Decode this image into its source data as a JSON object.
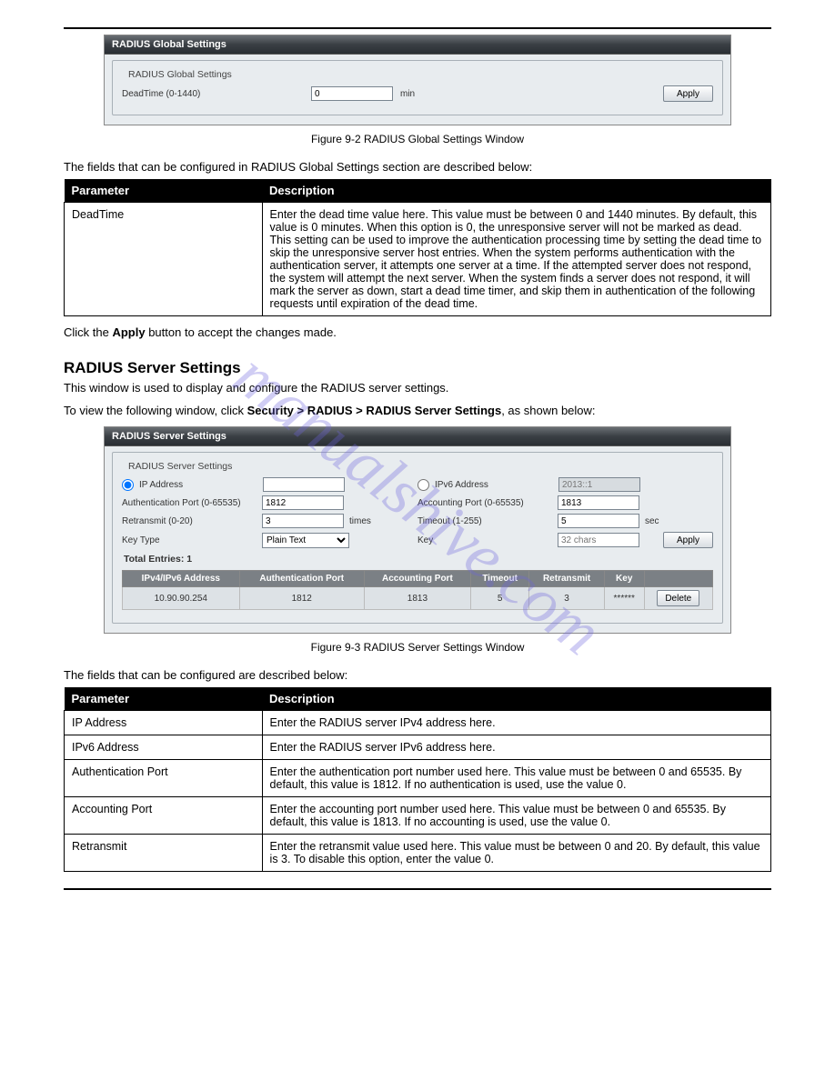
{
  "watermark": "manualshive.com",
  "screenshot1": {
    "title": "RADIUS Global Settings",
    "legend": "RADIUS Global Settings",
    "deadtime_label": "DeadTime (0-1440)",
    "deadtime_value": "0",
    "deadtime_unit": "min",
    "apply": "Apply",
    "caption": "Figure 9-2 RADIUS Global Settings Window"
  },
  "body1": {
    "intro": "The fields that can be configured in RADIUS Global Settings section are described below:"
  },
  "table1": {
    "hParam": "Parameter",
    "hDesc": "Description",
    "rows": [
      {
        "param": "DeadTime",
        "desc": "Enter the dead time value here. This value must be between 0 and 1440 minutes. By default, this value is 0 minutes. When this option is 0, the unresponsive server will not be marked as dead. This setting can be used to improve the authentication processing time by setting the dead time to skip the unresponsive server host entries. When the system performs authentication with the authentication server, it attempts one server at a time. If the attempted server does not respond, the system will attempt the next server. When the system finds a server does not respond, it will mark the server as down, start a dead time timer, and skip them in authentication of the following requests until expiration of the dead time."
      }
    ]
  },
  "apply_note": "Click the Apply button to accept the changes made.",
  "section2": {
    "heading": "RADIUS Server Settings",
    "sub": "This window is used to display and configure the RADIUS server settings.",
    "nav": "To view the following window, click Security > RADIUS > RADIUS Server Settings, as shown below:"
  },
  "screenshot2": {
    "title": "RADIUS Server Settings",
    "legend": "RADIUS Server Settings",
    "ip_label": "IP Address",
    "ip_value": "",
    "ipv6_label": "IPv6 Address",
    "ipv6_value": "2013::1",
    "auth_port_label": "Authentication Port (0-65535)",
    "auth_port_value": "1812",
    "acct_port_label": "Accounting Port (0-65535)",
    "acct_port_value": "1813",
    "retransmit_label": "Retransmit (0-20)",
    "retransmit_value": "3",
    "retransmit_unit": "times",
    "timeout_label": "Timeout (1-255)",
    "timeout_value": "5",
    "timeout_unit": "sec",
    "keytype_label": "Key Type",
    "keytype_value": "Plain Text",
    "key_label": "Key",
    "key_value": "",
    "key_placeholder": "32 chars",
    "apply": "Apply",
    "total": "Total Entries: 1",
    "headers": [
      "IPv4/IPv6 Address",
      "Authentication Port",
      "Accounting Port",
      "Timeout",
      "Retransmit",
      "Key",
      ""
    ],
    "row": [
      "10.90.90.254",
      "1812",
      "1813",
      "5",
      "3",
      "******"
    ],
    "delete": "Delete",
    "caption": "Figure 9-3 RADIUS Server Settings Window"
  },
  "body2": {
    "intro": "The fields that can be configured are described below:"
  },
  "table2": {
    "hParam": "Parameter",
    "hDesc": "Description",
    "rows": [
      {
        "param": "IP Address",
        "desc": "Enter the RADIUS server IPv4 address here."
      },
      {
        "param": "IPv6 Address",
        "desc": "Enter the RADIUS server IPv6 address here."
      },
      {
        "param": "Authentication Port",
        "desc": "Enter the authentication port number used here. This value must be between 0 and 65535. By default, this value is 1812. If no authentication is used, use the value 0."
      },
      {
        "param": "Accounting Port",
        "desc": "Enter the accounting port number used here. This value must be between 0 and 65535. By default, this value is 1813. If no accounting is used, use the value 0."
      },
      {
        "param": "Retransmit",
        "desc": "Enter the retransmit value used here. This value must be between 0 and 20. By default, this value is 3. To disable this option, enter the value 0."
      }
    ]
  }
}
